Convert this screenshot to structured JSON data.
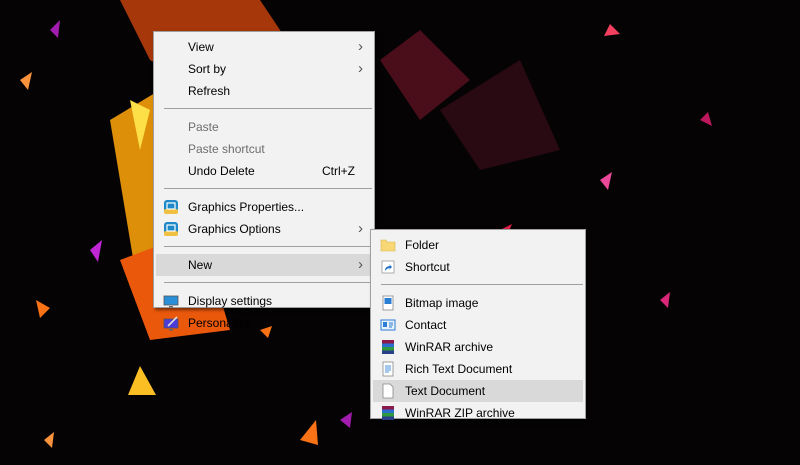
{
  "context_menu": {
    "items": [
      {
        "label": "View",
        "submenu": true
      },
      {
        "label": "Sort by",
        "submenu": true
      },
      {
        "label": "Refresh"
      },
      {
        "label": "Paste",
        "disabled": true
      },
      {
        "label": "Paste shortcut",
        "disabled": true
      },
      {
        "label": "Undo Delete",
        "shortcut": "Ctrl+Z"
      },
      {
        "label": "Graphics Properties...",
        "icon": "graphics-icon"
      },
      {
        "label": "Graphics Options",
        "icon": "graphics-icon",
        "submenu": true
      },
      {
        "label": "New",
        "submenu": true,
        "highlighted": true
      },
      {
        "label": "Display settings",
        "icon": "display-icon"
      },
      {
        "label": "Personalize",
        "icon": "personalize-icon"
      }
    ]
  },
  "new_submenu": {
    "items": [
      {
        "label": "Folder",
        "icon": "folder-icon"
      },
      {
        "label": "Shortcut",
        "icon": "shortcut-icon"
      },
      {
        "label": "Bitmap image",
        "icon": "bitmap-icon"
      },
      {
        "label": "Contact",
        "icon": "contact-icon"
      },
      {
        "label": "WinRAR archive",
        "icon": "winrar-icon"
      },
      {
        "label": "Rich Text Document",
        "icon": "rtf-icon"
      },
      {
        "label": "Text Document",
        "icon": "text-document-icon",
        "highlighted": true
      },
      {
        "label": "WinRAR ZIP archive",
        "icon": "winrar-zip-icon"
      }
    ]
  },
  "colors": {
    "menu_bg": "#f2f2f2",
    "highlight": "#d9d9d9",
    "disabled_text": "#6d6d6d"
  }
}
